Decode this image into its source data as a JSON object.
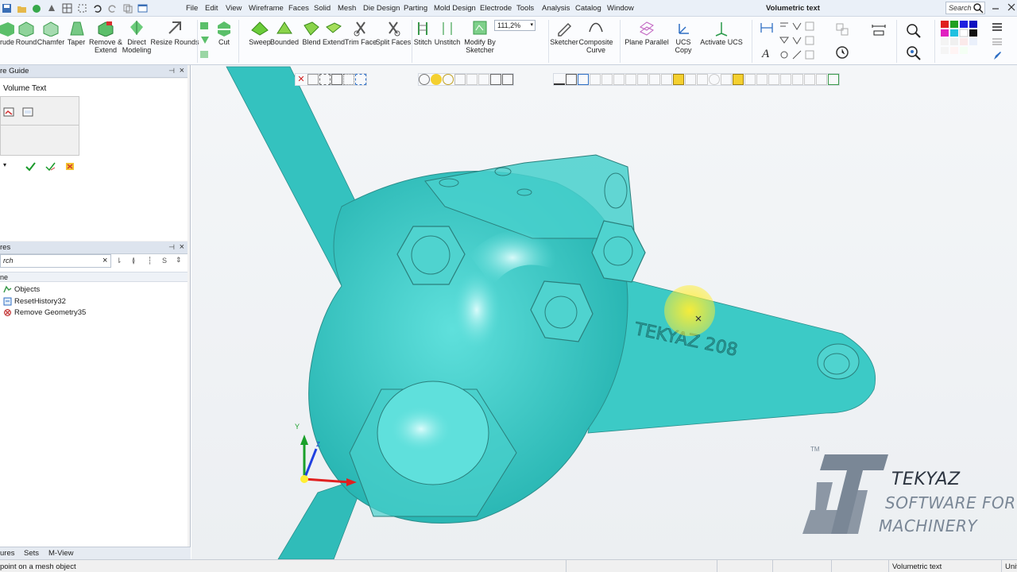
{
  "colors": {
    "model_fill": "#39c7c4",
    "model_edge": "#2a8f8c",
    "accent": "#2f6fc4",
    "cursor_highlight": "#ffee33",
    "logo_blue": "#7a8796",
    "logo_dark": "#2c3440"
  },
  "menu": {
    "items": [
      "File",
      "Edit",
      "View",
      "Wireframe",
      "Faces",
      "Solid",
      "Mesh",
      "Die Design",
      "Parting",
      "Mold Design",
      "Electrode",
      "Tools",
      "Analysis",
      "Catalog",
      "Window"
    ],
    "app_title": "Volumetric text",
    "search_placeholder": "Search"
  },
  "ribbon": {
    "buttons": {
      "extrude": "rude",
      "round": "Round",
      "chamfer": "Chamfer",
      "taper": "Taper",
      "remove_extend": "Remove &\nExtend",
      "direct_modeling": "Direct\nModeling",
      "resize_rounds": "Resize Rounds",
      "cut": "Cut",
      "sweep": "Sweep",
      "bounded": "Bounded",
      "blend": "Blend",
      "extend": "Extend",
      "trim_face": "Trim Face",
      "split_faces": "Split Faces",
      "stitch": "Stitch",
      "unstitch": "Unstitch",
      "modify_by_sketcher": "Modify By\nSketcher",
      "sketcher": "Sketcher",
      "composite_curve": "Composite\nCurve",
      "plane_parallel": "Plane Parallel",
      "ucs_copy": "UCS\nCopy",
      "activate_ucs": "Activate UCS"
    },
    "zoom_value": "111,2%"
  },
  "left_panel": {
    "guide_header": "re Guide",
    "volume_text_title": "Volume Text",
    "features_header": "res",
    "features_search_placeholder": "rch",
    "features_column": "ne",
    "tree": [
      {
        "label": "Objects",
        "icon": "objects-icon"
      },
      {
        "label": "ResetHistory32",
        "icon": "reset-history-icon"
      },
      {
        "label": "Remove Geometry35",
        "icon": "remove-geometry-icon"
      }
    ],
    "tabs": [
      "ures",
      "Sets",
      "M-View"
    ]
  },
  "status": {
    "message": "point on a mesh object",
    "mode": "Volumetric text",
    "units": "Unit"
  },
  "model": {
    "embossed_text": "TEKYAZ 208"
  },
  "axes": {
    "y_label": "Y",
    "z_label": "Z"
  },
  "logo": {
    "brand": "TEKYAZ",
    "tagline_line1": "SOFTWARE FOR",
    "tagline_line2": "MACHINERY",
    "tm": "TM"
  }
}
